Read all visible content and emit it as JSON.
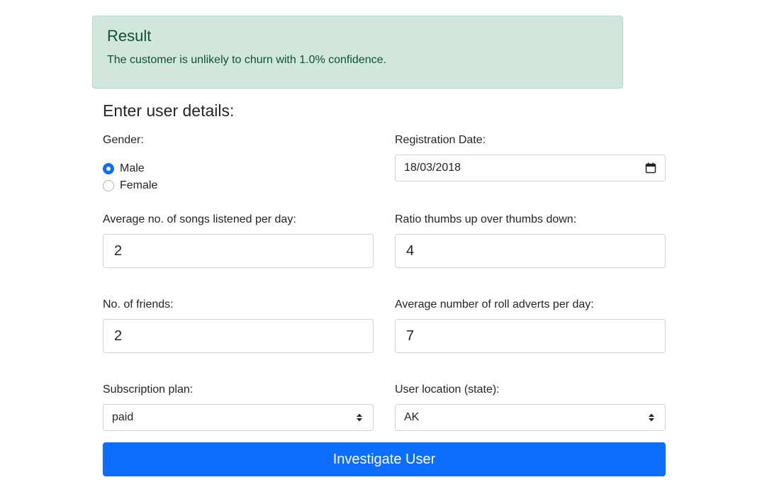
{
  "result": {
    "heading": "Result",
    "message": "The customer is unlikely to churn with 1.0% confidence."
  },
  "form": {
    "title": "Enter user details:",
    "gender": {
      "label": "Gender:",
      "options": [
        "Male",
        "Female"
      ],
      "selected": "Male"
    },
    "registration_date": {
      "label": "Registration Date:",
      "value": "18/03/2018"
    },
    "avg_songs": {
      "label": "Average no. of songs listened per day:",
      "value": "2"
    },
    "thumbs_ratio": {
      "label": "Ratio thumbs up over thumbs down:",
      "value": "4"
    },
    "friends": {
      "label": "No. of friends:",
      "value": "2"
    },
    "roll_adverts": {
      "label": "Average number of roll adverts per day:",
      "value": "7"
    },
    "subscription": {
      "label": "Subscription plan:",
      "value": "paid"
    },
    "location": {
      "label": "User location (state):",
      "value": "AK"
    },
    "submit_label": "Investigate User"
  },
  "colors": {
    "alert_bg": "#d1e7dd",
    "alert_text": "#0f5132",
    "primary": "#0d6efd"
  }
}
